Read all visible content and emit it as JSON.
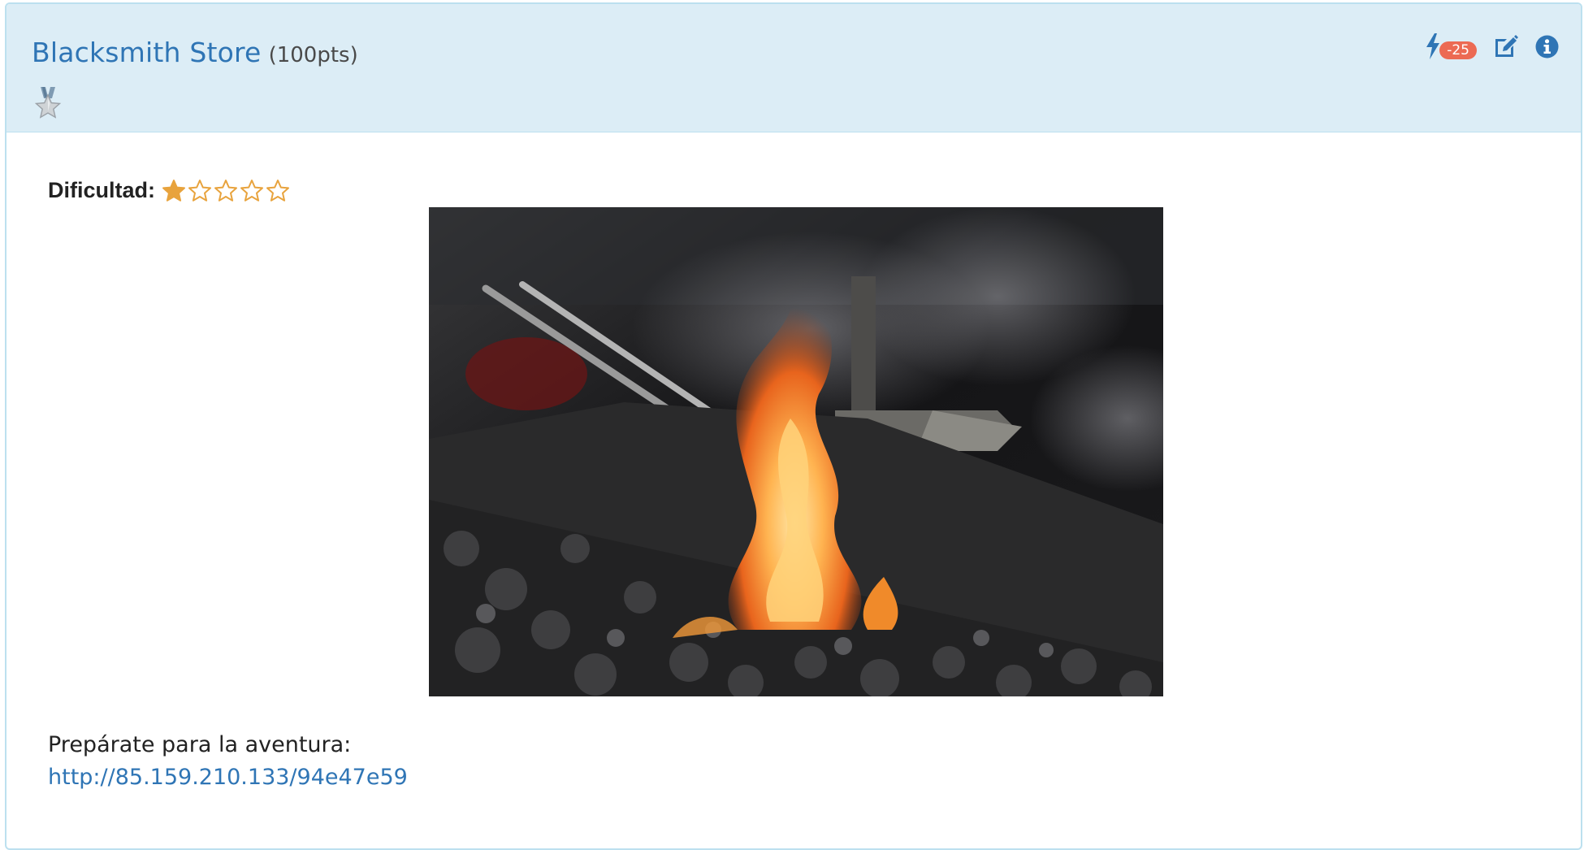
{
  "challenge": {
    "title": "Blacksmith Store",
    "points": "(100pts)",
    "medal_icon": "medal-star-icon"
  },
  "toolbar": {
    "hint_icon": "bolt-icon",
    "hint_penalty": "-25",
    "edit_icon": "edit-icon",
    "info_icon": "info-icon"
  },
  "difficulty": {
    "label": "Dificultad:",
    "rating": 1,
    "max": 5
  },
  "image": {
    "subject": "forge-fire-photo"
  },
  "body": {
    "intro": "Prepárate para la aventura:",
    "link": "http://85.159.210.133/94e47e59"
  },
  "colors": {
    "heading_bg": "#dcedf6",
    "border": "#bce0ef",
    "title": "#2f75b5",
    "link": "#2f75b5",
    "badge": "#ec6a53",
    "star": "#e8a33d"
  }
}
